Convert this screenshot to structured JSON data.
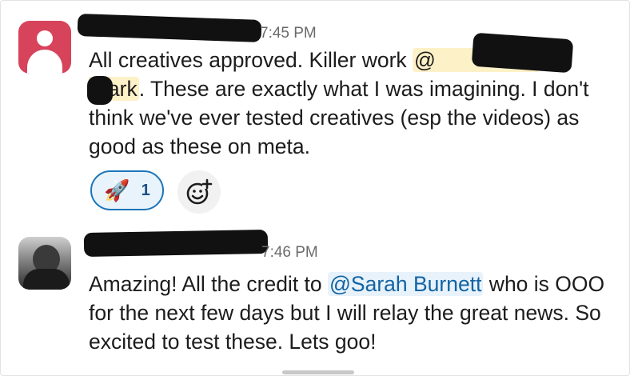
{
  "messages": [
    {
      "time": "7:45 PM",
      "text_before_mention": "All creatives approved. Killer work ",
      "mention": "@",
      "mention_tail": "lark",
      "text_line_rest": ". These are exactly what I was imagining. I don't think we've ever tested creatives (esp the videos) as good as these on meta.",
      "reactions": [
        {
          "emoji": "🚀",
          "count": "1",
          "emoji_name": "rocket-icon"
        }
      ]
    },
    {
      "time": "7:46 PM",
      "text_before_mention": "Amazing! All the credit to ",
      "mention": "@Sarah Burnett",
      "text_after_mention": " who is OOO for the next few days but I will relay the great news. So excited to test these. Lets goo!"
    }
  ],
  "icons": {
    "add_reaction": "add-reaction-icon"
  },
  "colors": {
    "avatar_red": "#d6435b",
    "reaction_border": "#1d75b8",
    "mention_blue": "#1264a3",
    "mention_yellow_bg": "#fdf1c7"
  }
}
